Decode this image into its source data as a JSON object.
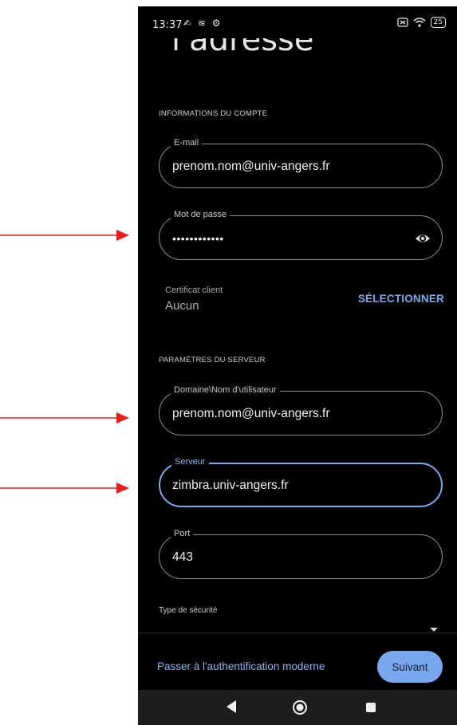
{
  "status_bar": {
    "time": "13:37",
    "left_icons": "✍ ≋ ⚙",
    "battery": "25"
  },
  "header": {
    "title_fragment": "l'adresse"
  },
  "account_section": {
    "label": "INFORMATIONS DU COMPTE",
    "email": {
      "label": "E-mail",
      "value": "prenom.nom@univ-angers.fr"
    },
    "password": {
      "label": "Mot de passe",
      "value": "••••••••••••"
    },
    "certificate": {
      "label": "Certificat client",
      "value": "Aucun",
      "action": "SÉLECTIONNER"
    }
  },
  "server_section": {
    "label": "PARAMÈTRES DU SERVEUR",
    "domain_user": {
      "label": "Domaine\\Nom d'utilisateur",
      "value": "prenom.nom@univ-angers.fr"
    },
    "server": {
      "label": "Serveur",
      "value": "zimbra.univ-angers.fr"
    },
    "port": {
      "label": "Port",
      "value": "443"
    },
    "security_type": {
      "label": "Type de sécurité"
    }
  },
  "footer": {
    "modern_auth_link": "Passer à l'authentification moderne",
    "next_button": "Suivant"
  },
  "colors": {
    "accent": "#7fa8e8",
    "background": "#000000",
    "annotation_arrow": "#e8201c"
  }
}
